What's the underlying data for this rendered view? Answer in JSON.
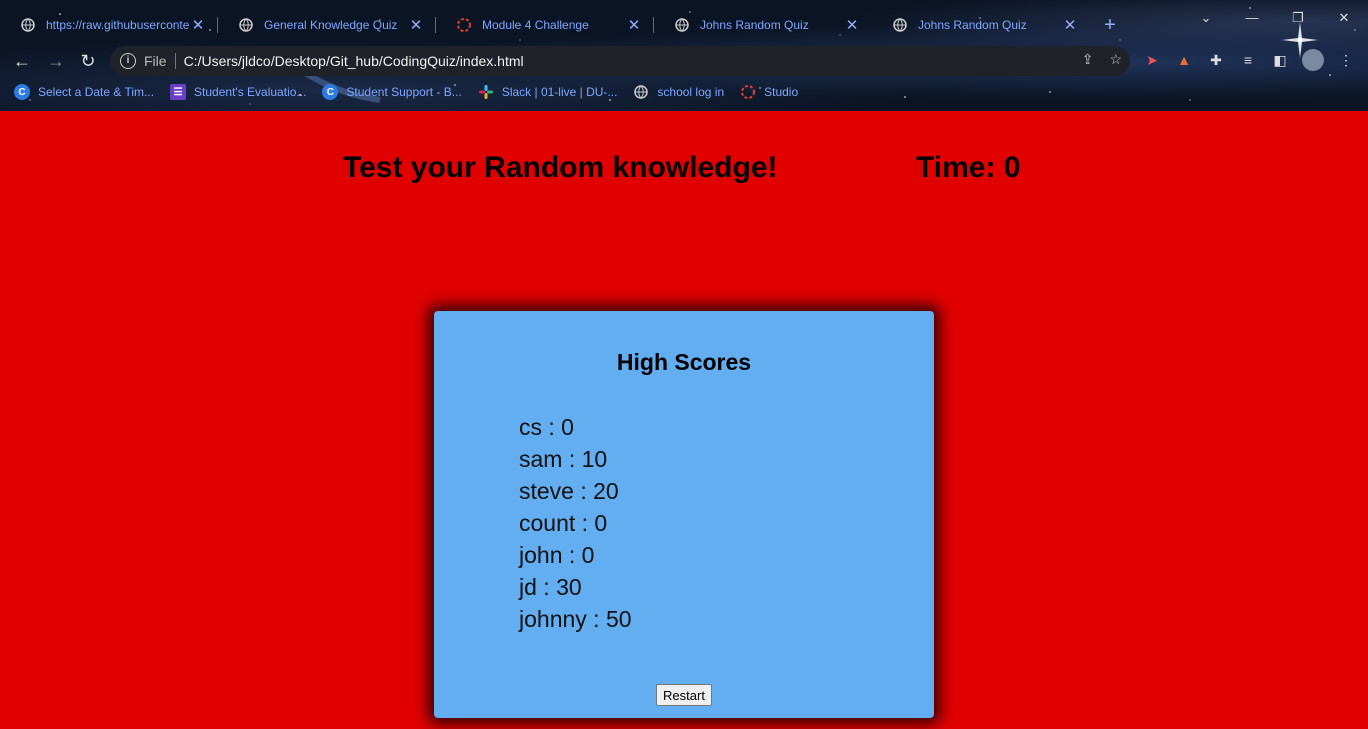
{
  "browser": {
    "tabs": [
      {
        "title": "https://raw.githubuserconte",
        "icon": "globe-icon"
      },
      {
        "title": "General Knowledge Quiz",
        "icon": "globe-icon"
      },
      {
        "title": "Module 4 Challenge",
        "icon": "ring-icon"
      },
      {
        "title": "Johns Random Quiz",
        "icon": "globe-icon"
      },
      {
        "title": "Johns Random Quiz",
        "icon": "globe-icon"
      }
    ],
    "address": {
      "scheme_label": "File",
      "url": "C:/Users/jldco/Desktop/Git_hub/CodingQuiz/index.html"
    },
    "bookmarks": [
      {
        "label": "Select a Date & Tim...",
        "icon": "c-logo-icon"
      },
      {
        "label": "Student's Evaluatio...",
        "icon": "form-icon"
      },
      {
        "label": "Student Support - B...",
        "icon": "c-logo-icon"
      },
      {
        "label": "Slack | 01-live | DU-...",
        "icon": "slack-icon"
      },
      {
        "label": "school log in",
        "icon": "globe-icon"
      },
      {
        "label": "Studio",
        "icon": "ring-icon"
      }
    ]
  },
  "page": {
    "heading": "Test your Random knowledge!",
    "timer": "Time: 0",
    "high_scores": {
      "title": "High Scores",
      "entries": [
        "cs : 0",
        "sam : 10",
        "steve : 20",
        "count : 0",
        "john : 0",
        "jd : 30",
        "johnny : 50"
      ],
      "restart_label": "Restart"
    }
  },
  "colors": {
    "page_background": "#e00000",
    "card_background": "#63aef0",
    "tab_text": "#7ea7ff"
  }
}
